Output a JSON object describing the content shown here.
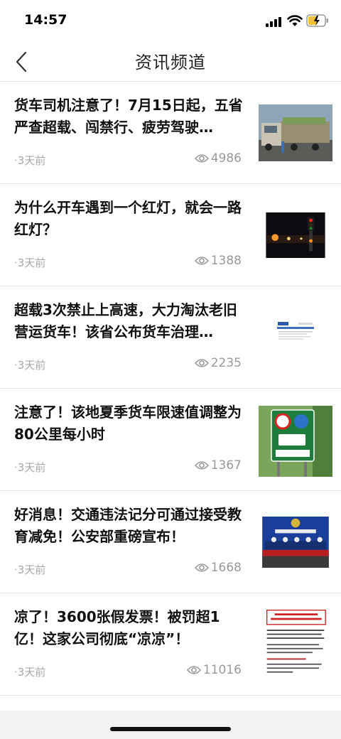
{
  "status_bar": {
    "time": "14:57"
  },
  "nav": {
    "title": "资讯频道"
  },
  "colors": {
    "divider": "#e6e6e6",
    "meta_text": "#a8a8a8",
    "title_text": "#111111",
    "accent_green": "#2e8b3a"
  },
  "news": [
    {
      "title": "货车司机注意了！7月15日起，五省严查超载、闯禁行、疲劳驾驶…",
      "time": "·3天前",
      "views": "4986",
      "thumb_icon": "truck-photo"
    },
    {
      "title": "为什么开车遇到一个红灯，就会一路红灯？",
      "time": "·3天前",
      "views": "1388",
      "thumb_icon": "traffic-light-photo"
    },
    {
      "title": "超载3次禁止上高速，大力淘汰老旧营运货车！该省公布货车治理…",
      "time": "·3天前",
      "views": "2235",
      "thumb_icon": "webpage-screenshot"
    },
    {
      "title": "注意了！该地夏季货车限速值调整为80公里每小时",
      "time": "·3天前",
      "views": "1367",
      "thumb_icon": "speed-limit-sign-photo"
    },
    {
      "title": "好消息！交通违法记分可通过接受教育减免！公安部重磅宣布！",
      "time": "·3天前",
      "views": "1668",
      "thumb_icon": "press-conference-photo"
    },
    {
      "title": "凉了！3600张假发票！被罚超1亿！这家公司彻底“凉凉”！",
      "time": "·3天前",
      "views": "11016",
      "thumb_icon": "document-photo"
    }
  ]
}
